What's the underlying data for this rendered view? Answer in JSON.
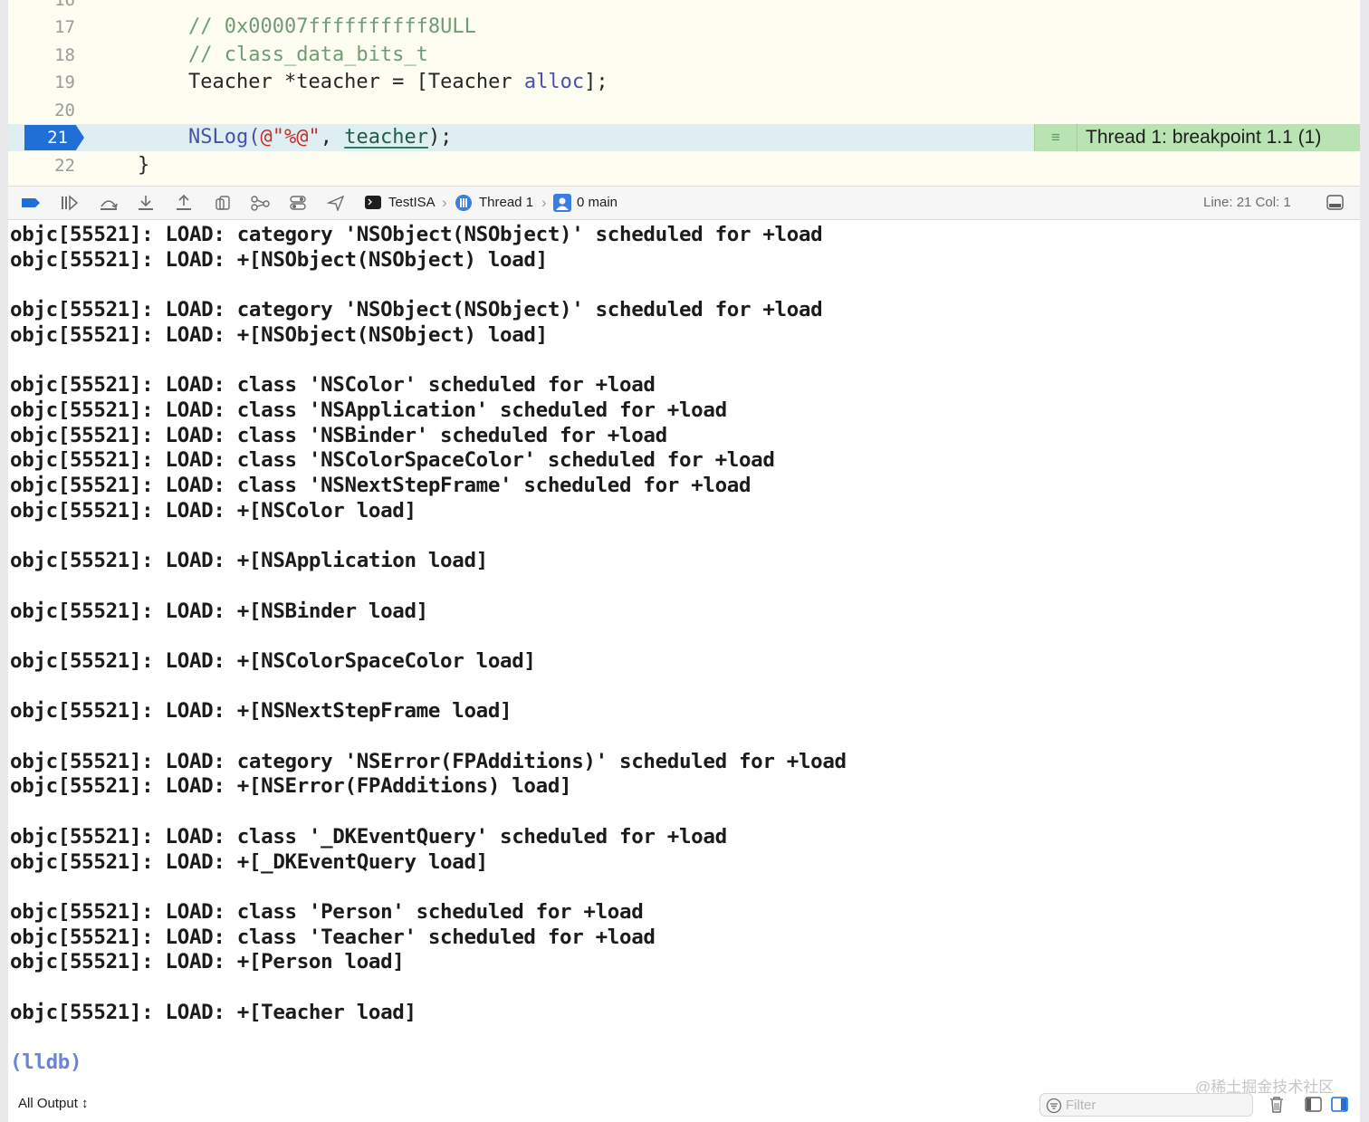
{
  "editor": {
    "partial_line_number": "16",
    "lines": [
      {
        "number": "17",
        "parts": [
          {
            "t": "// 0x00007ffffffffff8ULL",
            "c": "comment"
          }
        ]
      },
      {
        "number": "18",
        "parts": [
          {
            "t": "// class_data_bits_t",
            "c": "comment"
          }
        ]
      },
      {
        "number": "19",
        "parts": [
          {
            "t": "Teacher *teacher = [Teacher ",
            "c": "plain"
          },
          {
            "t": "alloc",
            "c": "keyword"
          },
          {
            "t": "];",
            "c": "plain"
          }
        ]
      },
      {
        "number": "20",
        "parts": []
      },
      {
        "number": "21",
        "current": true,
        "parts": [
          {
            "t": "NSLog(",
            "c": "keyword"
          },
          {
            "t": "@\"%@\"",
            "c": "string"
          },
          {
            "t": ", ",
            "c": "plain"
          },
          {
            "t": "teacher",
            "c": "teacher"
          },
          {
            "t": ");",
            "c": "plain"
          }
        ]
      },
      {
        "number": "22",
        "close": true,
        "parts": [
          {
            "t": "}",
            "c": "plain"
          }
        ]
      }
    ],
    "breakpoint_banner": "Thread 1: breakpoint 1.1 (1)",
    "banner_icon": "lines-icon"
  },
  "debug_bar": {
    "toolbar_icons": [
      "breakpoint-toggle-icon",
      "continue-icon",
      "step-over-icon",
      "step-into-icon",
      "step-out-icon",
      "view-hierarchy-icon",
      "memory-graph-icon",
      "environment-overrides-icon",
      "location-icon"
    ],
    "breadcrumb": {
      "target": "TestISA",
      "thread": "Thread 1",
      "frame": "0 main"
    },
    "line_col": "Line: 21  Col: 1",
    "accent": "#1f6fd6"
  },
  "console": {
    "lines": [
      "objc[55521]: LOAD: category 'NSObject(NSObject)' scheduled for +load",
      "objc[55521]: LOAD: +[NSObject(NSObject) load]",
      "",
      "objc[55521]: LOAD: category 'NSObject(NSObject)' scheduled for +load",
      "objc[55521]: LOAD: +[NSObject(NSObject) load]",
      "",
      "objc[55521]: LOAD: class 'NSColor' scheduled for +load",
      "objc[55521]: LOAD: class 'NSApplication' scheduled for +load",
      "objc[55521]: LOAD: class 'NSBinder' scheduled for +load",
      "objc[55521]: LOAD: class 'NSColorSpaceColor' scheduled for +load",
      "objc[55521]: LOAD: class 'NSNextStepFrame' scheduled for +load",
      "objc[55521]: LOAD: +[NSColor load]",
      "",
      "objc[55521]: LOAD: +[NSApplication load]",
      "",
      "objc[55521]: LOAD: +[NSBinder load]",
      "",
      "objc[55521]: LOAD: +[NSColorSpaceColor load]",
      "",
      "objc[55521]: LOAD: +[NSNextStepFrame load]",
      "",
      "objc[55521]: LOAD: category 'NSError(FPAdditions)' scheduled for +load",
      "objc[55521]: LOAD: +[NSError(FPAdditions) load]",
      "",
      "objc[55521]: LOAD: class '_DKEventQuery' scheduled for +load",
      "objc[55521]: LOAD: +[_DKEventQuery load]",
      "",
      "objc[55521]: LOAD: class 'Person' scheduled for +load",
      "objc[55521]: LOAD: class 'Teacher' scheduled for +load",
      "objc[55521]: LOAD: +[Person load]",
      "",
      "objc[55521]: LOAD: +[Teacher load]"
    ],
    "prompt": "(lldb)"
  },
  "footer": {
    "output_select": "All Output ↕",
    "filter_placeholder": "Filter",
    "watermark": "@稀土掘金技术社区",
    "buttons": [
      "trash-icon",
      "split-left-icon",
      "split-right-icon"
    ]
  }
}
